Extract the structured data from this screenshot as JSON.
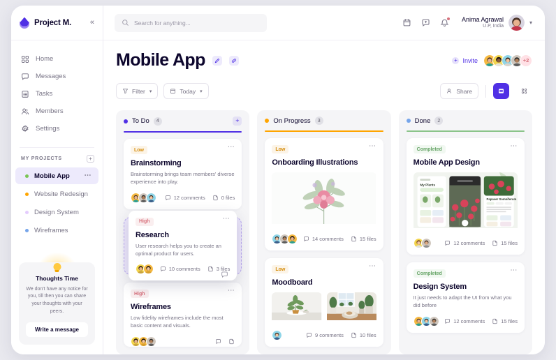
{
  "sidebar": {
    "brand": "Project M.",
    "collapse_icon": "chevron-double-left-icon",
    "nav": [
      {
        "label": "Home",
        "icon": "grid-icon"
      },
      {
        "label": "Messages",
        "icon": "chat-icon"
      },
      {
        "label": "Tasks",
        "icon": "clipboard-list-icon"
      },
      {
        "label": "Members",
        "icon": "users-icon"
      },
      {
        "label": "Settings",
        "icon": "gear-icon"
      }
    ],
    "projects_label": "MY PROJECTS",
    "projects_add_icon": "plus-icon",
    "projects": [
      {
        "label": "Mobile App",
        "color": "#7ac555",
        "active": true
      },
      {
        "label": "Website Redesign",
        "color": "#ffa500",
        "active": false
      },
      {
        "label": "Design System",
        "color": "#e4ccfd",
        "active": false
      },
      {
        "label": "Wireframes",
        "color": "#76a5ea",
        "active": false
      }
    ],
    "thoughts": {
      "icon": "lightbulb-icon",
      "title": "Thoughts Time",
      "body": "We don't have any notice for you, till then you can share your thoughts with your peers.",
      "button": "Write a message"
    }
  },
  "topbar": {
    "search": {
      "placeholder": "Search for anything...",
      "value": "",
      "icon": "search-icon"
    },
    "icons": [
      "calendar-icon",
      "question-chat-icon",
      "bell-icon"
    ],
    "user": {
      "name": "Anima Agrawal",
      "location": "U.P, India"
    }
  },
  "header": {
    "title": "Mobile App",
    "edit_icon": "pencil-icon",
    "link_icon": "link-icon",
    "invite_label": "Invite",
    "invite_plus": "+",
    "avatars_overflow": "+2",
    "avatar_colors": [
      "#f5b841",
      "#f3d44b",
      "#8ed5e8",
      "#cfc6bd"
    ]
  },
  "toolbar": {
    "filter_label": "Filter",
    "filter_icon": "funnel-icon",
    "today_label": "Today",
    "today_icon": "calendar-icon",
    "chevron": "chevron-down-icon",
    "share_label": "Share",
    "share_icon": "share-user-icon",
    "view_list_icon": "list-view-icon",
    "view_grid_icon": "grid-view-icon"
  },
  "board": {
    "columns": [
      {
        "name": "To Do",
        "count": "4",
        "dot_color": "#5030e5",
        "rule_color": "#5030e5",
        "has_add": true,
        "add_icon": "plus-icon",
        "cards": [
          {
            "priority": "Low",
            "priority_class": "low",
            "title": "Brainstorming",
            "desc": "Brainstorming brings team members' diverse experience into play.",
            "comments": "12 comments",
            "files": "0 files",
            "avatars": [
              "#f5b841",
              "#cfc6bd",
              "#8ed5e8"
            ]
          },
          {
            "priority": "High",
            "priority_class": "high",
            "title": "Research",
            "desc": "User research helps you to create an optimal product for users.",
            "comments": "10 comments",
            "files": "3 files",
            "avatars": [
              "#f3d44b",
              "#f5b841"
            ],
            "dragging": true
          },
          {
            "priority": "High",
            "priority_class": "high",
            "title": "Wireframes",
            "desc": "Low fidelity wireframes include the most basic content and visuals.",
            "comments": "",
            "files": "",
            "avatars": [
              "#f3d44b",
              "#f5b841",
              "#cfc6bd"
            ]
          }
        ]
      },
      {
        "name": "On Progress",
        "count": "3",
        "dot_color": "#ffa500",
        "rule_color": "#ffa500",
        "has_add": false,
        "cards": [
          {
            "priority": "Low",
            "priority_class": "low",
            "title": "Onboarding Illustrations",
            "desc": "",
            "comments": "14 comments",
            "files": "15 files",
            "avatars": [
              "#8ed5e8",
              "#cfc6bd",
              "#f5b841"
            ],
            "image": "floral-illustration"
          },
          {
            "priority": "Low",
            "priority_class": "low",
            "title": "Moodboard",
            "desc": "",
            "comments": "9 comments",
            "files": "10 files",
            "avatars": [
              "#8ed5e8"
            ],
            "image": "moodboard-pair"
          }
        ]
      },
      {
        "name": "Done",
        "count": "2",
        "dot_color": "#76a5ea",
        "rule_color": "#8bc48a",
        "has_add": false,
        "cards": [
          {
            "priority": "Completed",
            "priority_class": "completed",
            "title": "Mobile App Design",
            "desc": "",
            "comments": "12 comments",
            "files": "15 files",
            "avatars": [
              "#f3d44b",
              "#cfc6bd"
            ],
            "image": "app-screens"
          },
          {
            "priority": "Completed",
            "priority_class": "completed",
            "title": "Design System",
            "desc": "It just needs to adapt the UI from what you did before",
            "comments": "12 comments",
            "files": "15 files",
            "avatars": [
              "#f5b841",
              "#8ed5e8",
              "#cfc6bd"
            ]
          }
        ]
      }
    ]
  }
}
